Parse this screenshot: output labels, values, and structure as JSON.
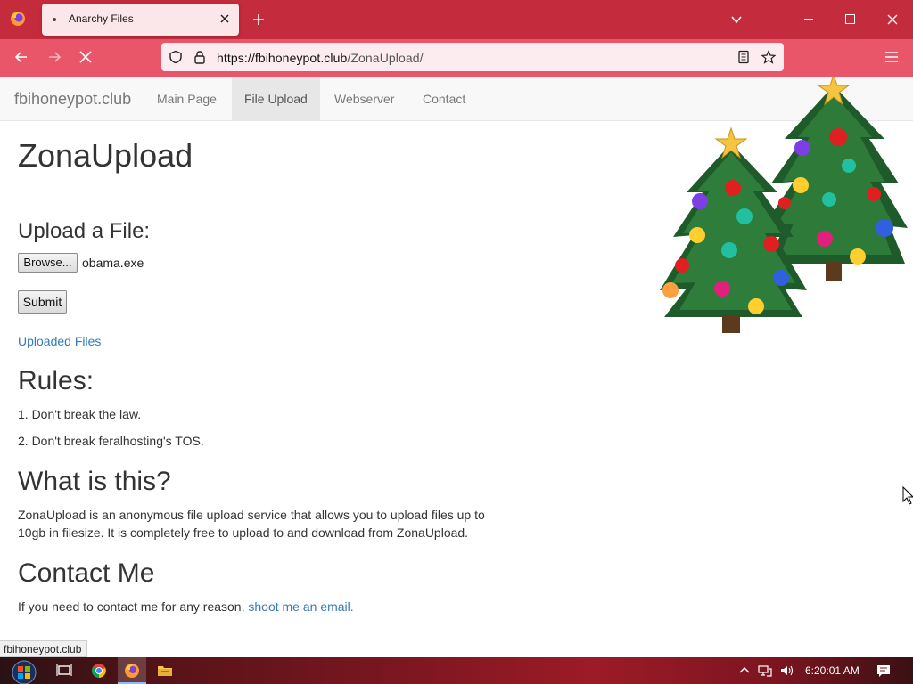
{
  "browser": {
    "tab_title": "Anarchy Files",
    "url_domain": "https://fbihoneypot.club",
    "url_path": "/ZonaUpload/"
  },
  "site": {
    "brand": "fbihoneypot.club",
    "nav": [
      "Main Page",
      "File Upload",
      "Webserver",
      "Contact"
    ],
    "active_nav": "File Upload"
  },
  "page": {
    "title": "ZonaUpload",
    "upload_heading": "Upload a File:",
    "browse_label": "Browse...",
    "selected_file": "obama.exe",
    "submit_label": "Submit",
    "uploaded_link": "Uploaded Files",
    "rules_heading": "Rules:",
    "rules": [
      "1. Don't break the law.",
      "2. Don't break feralhosting's TOS."
    ],
    "about_heading": "What is this?",
    "about_text_1": "ZonaUpload is an anonymous file upload service that allows you to upload files up to",
    "about_text_2": "10gb in filesize. It is completely free to upload to and download from ZonaUpload.",
    "contact_heading": "Contact Me",
    "contact_text": "If you need to contact me for any reason, ",
    "contact_link": "shoot me an email."
  },
  "status_url": "fbihoneypot.club",
  "taskbar": {
    "clock": "6:20:01 AM"
  },
  "colors": {
    "tabbar": "#c42b3d",
    "navbar": "#e9566a",
    "link": "#337ab7"
  }
}
